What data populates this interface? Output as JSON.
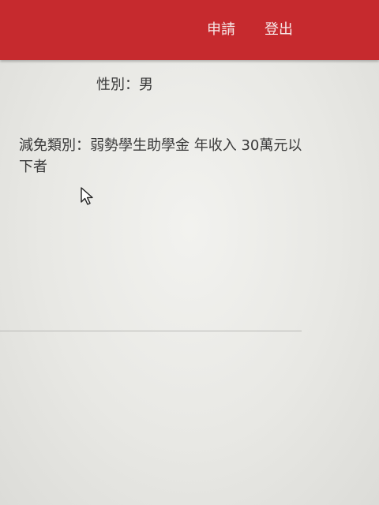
{
  "header": {
    "apply_label": "申請",
    "logout_label": "登出",
    "brand_color": "#c62a2e"
  },
  "fields": {
    "gender_label": "性別：",
    "gender_value": "男",
    "reduction_label": "減免類別：",
    "reduction_value": "弱勢學生助學金 年收入 30萬元以下者"
  },
  "cursor_icon": "arrow-cursor-icon"
}
